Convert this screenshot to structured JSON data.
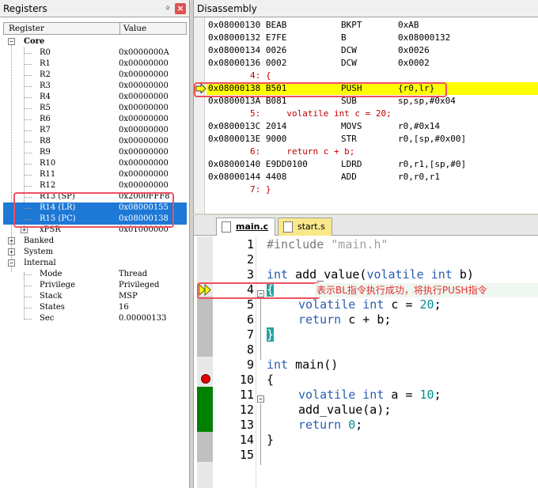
{
  "registers": {
    "title": "Registers",
    "pin_icon": "pin-icon",
    "close_icon": "close-icon",
    "col_register": "Register",
    "col_value": "Value",
    "core_label": "Core",
    "rows": [
      {
        "name": "R0",
        "value": "0x0000000A"
      },
      {
        "name": "R1",
        "value": "0x00000000"
      },
      {
        "name": "R2",
        "value": "0x00000000"
      },
      {
        "name": "R3",
        "value": "0x00000000"
      },
      {
        "name": "R4",
        "value": "0x00000000"
      },
      {
        "name": "R5",
        "value": "0x00000000"
      },
      {
        "name": "R6",
        "value": "0x00000000"
      },
      {
        "name": "R7",
        "value": "0x00000000"
      },
      {
        "name": "R8",
        "value": "0x00000000"
      },
      {
        "name": "R9",
        "value": "0x00000000"
      },
      {
        "name": "R10",
        "value": "0x00000000"
      },
      {
        "name": "R11",
        "value": "0x00000000"
      },
      {
        "name": "R12",
        "value": "0x00000000"
      },
      {
        "name": "R13 (SP)",
        "value": "0x2000FFF8"
      },
      {
        "name": "R14 (LR)",
        "value": "0x08000155"
      },
      {
        "name": "R15 (PC)",
        "value": "0x08000138"
      },
      {
        "name": "xPSR",
        "value": "0x01000000"
      }
    ],
    "banked_label": "Banked",
    "system_label": "System",
    "internal_label": "Internal",
    "internal_rows": [
      {
        "name": "Mode",
        "value": "Thread"
      },
      {
        "name": "Privilege",
        "value": "Privileged"
      },
      {
        "name": "Stack",
        "value": "MSP"
      },
      {
        "name": "States",
        "value": "16"
      },
      {
        "name": "Sec",
        "value": "0.00000133"
      }
    ]
  },
  "disassembly": {
    "title": "Disassembly",
    "lines": [
      {
        "addr": "0x08000130 BEAB",
        "mnem": "BKPT",
        "ops": "0xAB"
      },
      {
        "addr": "0x08000132 E7FE",
        "mnem": "B",
        "ops": "0x08000132"
      },
      {
        "addr": "0x08000134 0026",
        "mnem": "DCW",
        "ops": "0x0026"
      },
      {
        "addr": "0x08000136 0002",
        "mnem": "DCW",
        "ops": "0x0002"
      },
      {
        "src": "        4: {"
      },
      {
        "addr": "0x08000138 B501",
        "mnem": "PUSH",
        "ops": "{r0,lr}"
      },
      {
        "addr": "0x0800013A B081",
        "mnem": "SUB",
        "ops": "sp,sp,#0x04"
      },
      {
        "src": "        5:     volatile int c = 20;"
      },
      {
        "addr": "0x0800013C 2014",
        "mnem": "MOVS",
        "ops": "r0,#0x14"
      },
      {
        "addr": "0x0800013E 9000",
        "mnem": "STR",
        "ops": "r0,[sp,#0x00]"
      },
      {
        "src": "        6:     return c + b;"
      },
      {
        "addr": "0x08000140 E9DD0100",
        "mnem": "LDRD",
        "ops": "r0,r1,[sp,#0]"
      },
      {
        "addr": "0x08000144 4408",
        "mnem": "ADD",
        "ops": "r0,r0,r1"
      },
      {
        "src": "        7: }"
      }
    ]
  },
  "editor": {
    "tabs": [
      {
        "label": "main.c"
      },
      {
        "label": "start.s"
      }
    ],
    "line_numbers": [
      "1",
      "2",
      "3",
      "4",
      "5",
      "6",
      "7",
      "8",
      "9",
      "10",
      "11",
      "12",
      "13",
      "14",
      "15"
    ],
    "code": {
      "l1_pp": "#include ",
      "l1_str": "\"main.h\"",
      "l3_kw1": "int",
      "l3_mid": " add_value(",
      "l3_kw2": "volatile int",
      "l3_end": " b)",
      "l4": "{",
      "l5_kw": "volatile int",
      "l5_mid": " c = ",
      "l5_num": "20",
      "l5_end": ";",
      "l6_kw": "return",
      "l6_end": " c + b;",
      "l7": "}",
      "l9_kw": "int",
      "l9_end": " main()",
      "l10": "{",
      "l11_kw": "volatile int",
      "l11_mid": " a = ",
      "l11_num": "10",
      "l11_end": ";",
      "l12": "add_value(a);",
      "l13_kw": "return",
      "l13_mid": " ",
      "l13_num": "0",
      "l13_end": ";",
      "l14": "}"
    },
    "annotation": "表示BL指令执行成功，将执行PUSH指令"
  },
  "colors": {
    "highlight": "#ffff00",
    "selection": "#1e78d6",
    "callout": "#ee5060",
    "breakpoint": "#e00000",
    "coverage_green": "#008000"
  }
}
